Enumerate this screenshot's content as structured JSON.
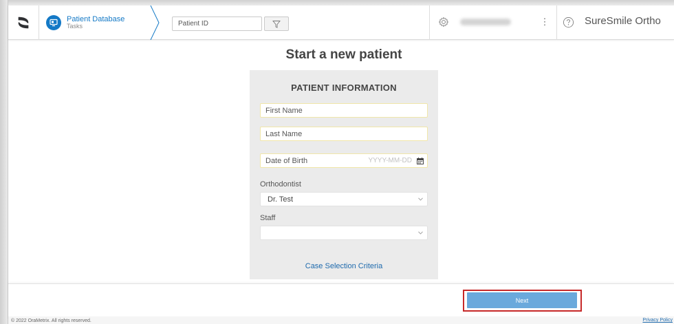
{
  "header": {
    "nav_title": "Patient Database",
    "nav_subtitle": "Tasks",
    "patient_id_placeholder": "Patient ID",
    "kebab": "⋮",
    "brand": "SureSmile Ortho"
  },
  "main": {
    "page_title": "Start a new patient",
    "panel_title": "PATIENT INFORMATION",
    "first_name_placeholder": "First Name",
    "last_name_placeholder": "Last Name",
    "dob_label": "Date of Birth",
    "dob_hint": "YYYY-MM-DD",
    "orthodontist_label": "Orthodontist",
    "orthodontist_value": "Dr. Test",
    "staff_label": "Staff",
    "staff_value": "",
    "case_link": "Case Selection Criteria"
  },
  "footer": {
    "next_label": "Next",
    "copyright": "© 2022 OraMetrix. All rights reserved.",
    "privacy": "Privacy Policy"
  },
  "colors": {
    "accent": "#1479c6",
    "next_button": "#6aa9dc",
    "highlight": "#c62828",
    "panel_bg": "#ebebeb"
  },
  "icons": {
    "logo": "suresmile-logo-icon",
    "database": "database-icon",
    "filter": "filter-icon",
    "settings": "gear-icon",
    "help": "help-icon",
    "calendar": "calendar-icon",
    "select": "chevron-down-icon"
  }
}
